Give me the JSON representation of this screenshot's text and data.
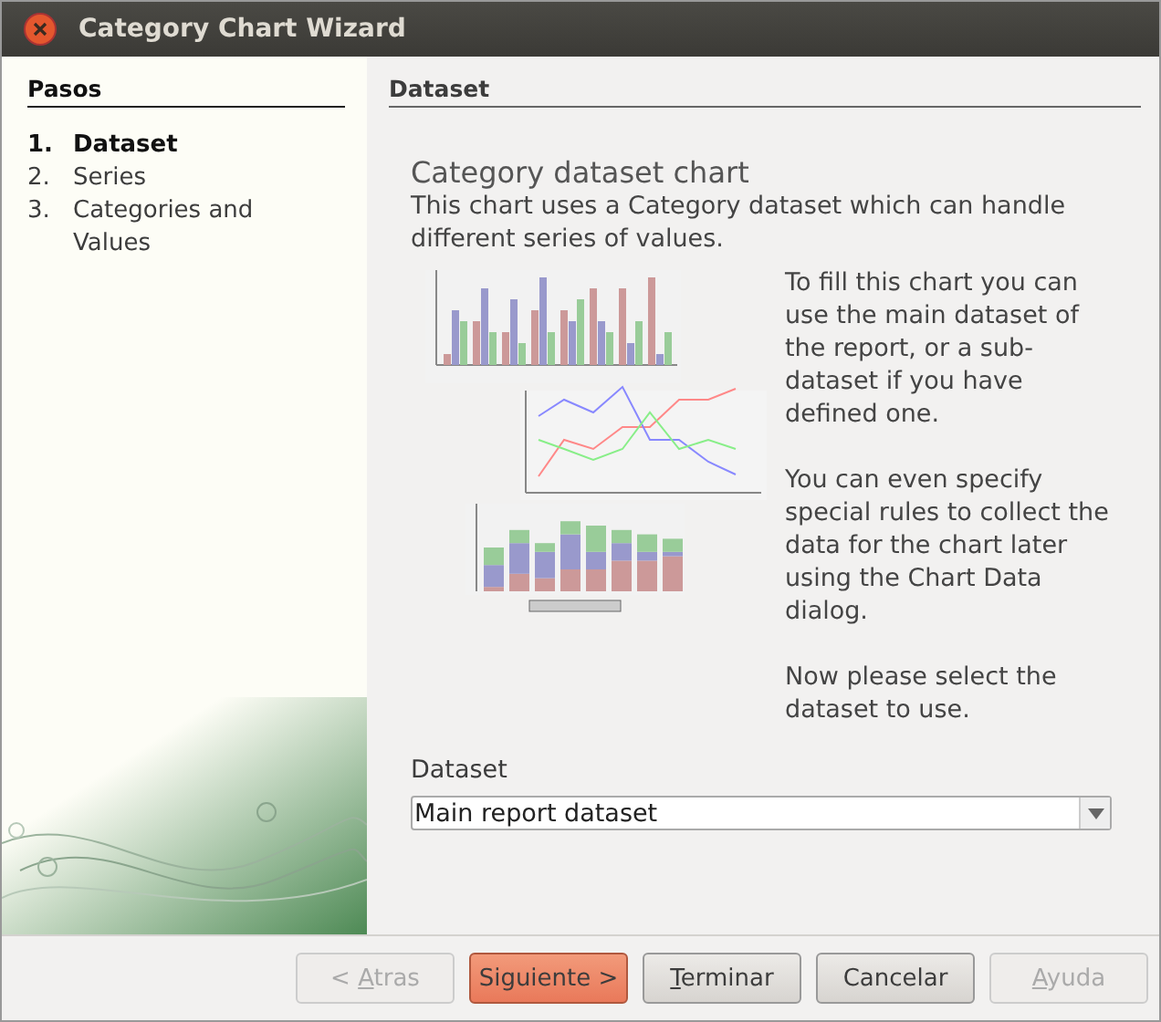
{
  "window": {
    "title": "Category Chart Wizard"
  },
  "steps": {
    "heading": "Pasos",
    "items": [
      {
        "number": "1.",
        "label": "Dataset",
        "selected": true
      },
      {
        "number": "2.",
        "label": "Series",
        "selected": false
      },
      {
        "number": "3.",
        "label": "Categories and Values",
        "selected": false
      }
    ]
  },
  "panel": {
    "heading": "Dataset",
    "title": "Category dataset chart",
    "description": "This chart uses a Category dataset which can handle different series of values.",
    "help_paragraphs": [
      "To fill this chart you can use the main dataset of the report, or a sub-dataset if you have defined one.",
      "You can even specify special rules to collect the data for the chart later using the Chart Data dialog.",
      "Now please select the dataset to use."
    ],
    "dataset_label": "Dataset",
    "dataset_value": "Main report dataset"
  },
  "buttons": [
    {
      "before": "< ",
      "key": "A",
      "after": "tras",
      "disabled": true,
      "default": false
    },
    {
      "before": "Siguiente >",
      "disabled": false,
      "default": true
    },
    {
      "key": "T",
      "after": "erminar",
      "disabled": false,
      "default": false
    },
    {
      "before": "Cancelar",
      "disabled": false,
      "default": false
    },
    {
      "key": "A",
      "after": "yuda",
      "disabled": true,
      "default": false
    }
  ]
}
